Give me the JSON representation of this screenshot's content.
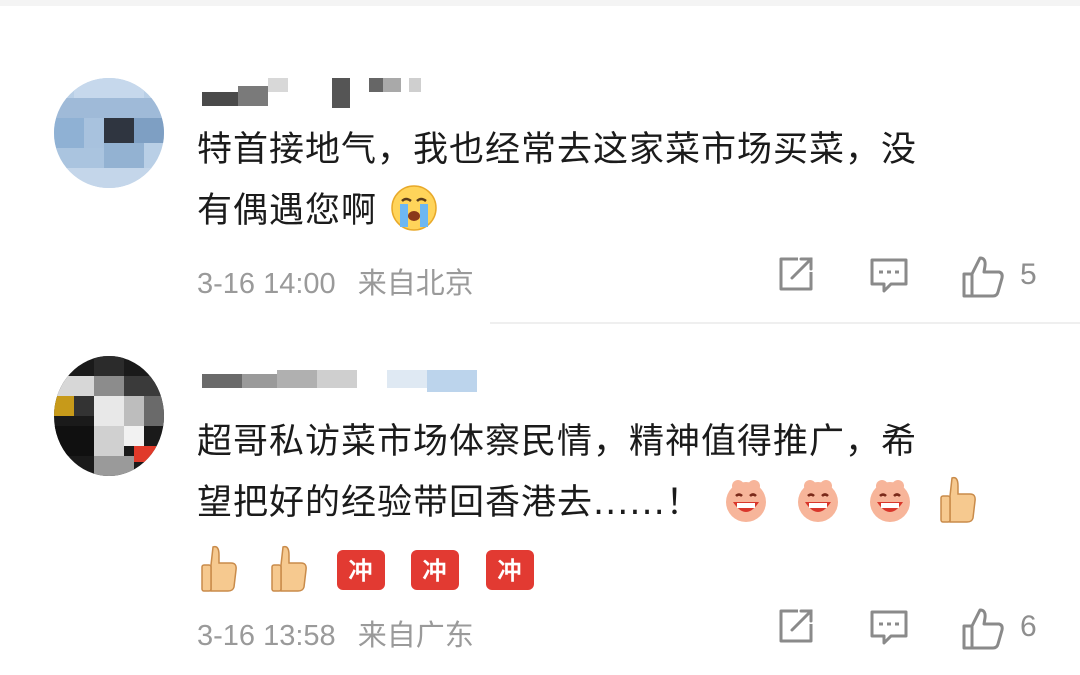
{
  "comments": [
    {
      "text_line1": "特首接地气，我也经常去这家菜市场买菜，没",
      "text_line2": "有偶遇您啊",
      "emojis": [
        "crying-emoji"
      ],
      "time": "3-16 14:00",
      "location": "来自北京",
      "like_count": "5",
      "avatar_style": "pixelated-blue"
    },
    {
      "text_line1": "超哥私访菜市场体察民情，精神值得推广，希",
      "text_line2": "望把好的经验带回香港去......！",
      "line2_emojis": [
        "grinning-emoji",
        "grinning-emoji",
        "grinning-emoji",
        "thumbs-up-emoji"
      ],
      "line3_emojis": [
        "thumbs-up-emoji",
        "thumbs-up-emoji",
        "fighting-emoji",
        "fighting-emoji",
        "fighting-emoji"
      ],
      "fighting_label": "冲",
      "time": "3-16 13:58",
      "location": "来自广东",
      "like_count": "6",
      "avatar_style": "pixelated-dark"
    }
  ],
  "icons": {
    "share": "share-icon",
    "reply": "comment-icon",
    "like": "thumbs-up-outline-icon"
  },
  "colors": {
    "text": "#1b1b1b",
    "meta": "#9a9a9a",
    "icon": "#8a8a8a"
  }
}
